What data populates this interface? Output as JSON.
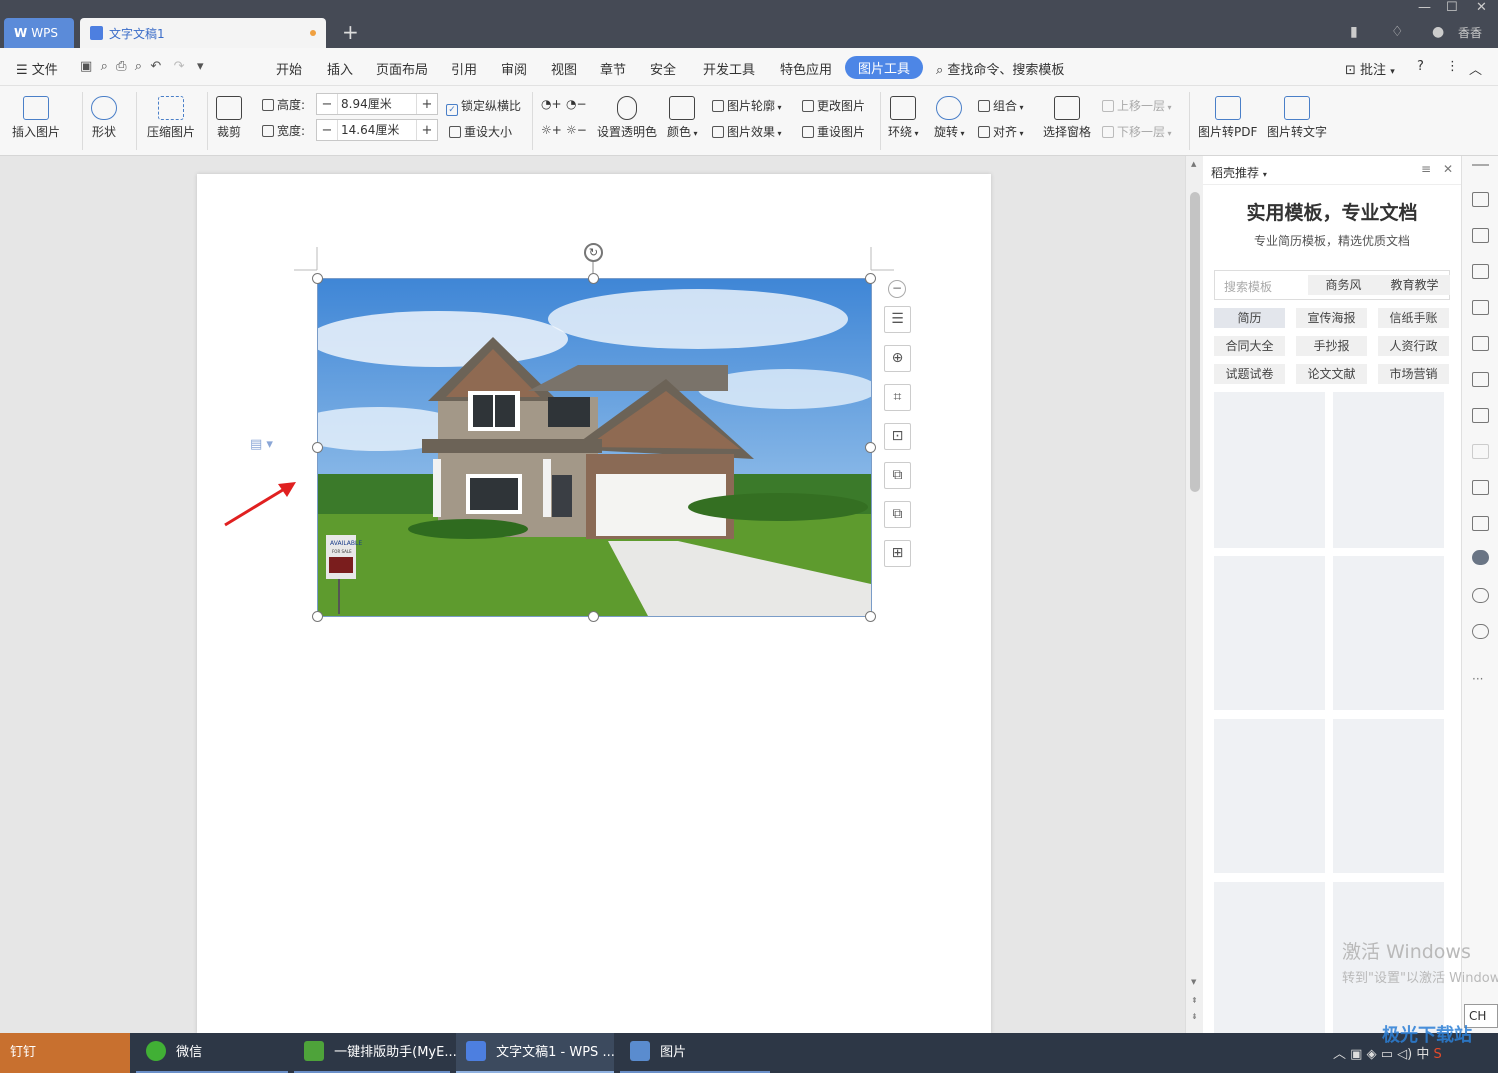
{
  "titlebar": {
    "app_tab": "WPS",
    "doc_tab": "文字文稿1",
    "user": "香香"
  },
  "menu": {
    "file": "文件",
    "items": [
      "开始",
      "插入",
      "页面布局",
      "引用",
      "审阅",
      "视图",
      "章节",
      "安全",
      "开发工具",
      "特色应用"
    ],
    "active": "图片工具",
    "search": "查找命令、搜索模板",
    "annotate": "批注",
    "help": "?"
  },
  "ribbon": {
    "insert_picture": "插入图片",
    "shape": "形状",
    "compress": "压缩图片",
    "crop": "裁剪",
    "height_label": "高度:",
    "height_value": "8.94厘米",
    "width_label": "宽度:",
    "width_value": "14.64厘米",
    "lock_ratio": "锁定纵横比",
    "reset_size": "重设大小",
    "set_transparent": "设置透明色",
    "color": "颜色",
    "outline": "图片轮廓",
    "effects": "图片效果",
    "change_picture": "更改图片",
    "reset_picture": "重设图片",
    "wrap": "环绕",
    "rotate": "旋转",
    "group": "组合",
    "align": "对齐",
    "selection_pane": "选择窗格",
    "bring_forward": "上移一层",
    "send_backward": "下移一层",
    "to_pdf": "图片转PDF",
    "to_text": "图片转文字"
  },
  "photo": {
    "sign_line1": "AVAILABLE",
    "sign_line2": "FOR SALE"
  },
  "panel": {
    "header": "稻壳推荐",
    "title": "实用模板，专业文档",
    "subtitle": "专业简历模板，精选优质文档",
    "search_placeholder": "搜索模板",
    "search_tabs": [
      "商务风",
      "教育教学"
    ],
    "categories": [
      "简历",
      "宣传海报",
      "信纸手账",
      "合同大全",
      "手抄报",
      "人资行政",
      "试题试卷",
      "论文文献",
      "市场营销"
    ]
  },
  "watermark": {
    "line1": "激活 Windows",
    "line2": "转到\"设置\"以激活 Windows"
  },
  "ime": "CH",
  "taskbar": {
    "items": [
      "钉钉",
      "微信",
      "一键排版助手(MyE...",
      "文字文稿1 - WPS ...",
      "图片"
    ],
    "tray_ime": "中",
    "site_logo": "极光下载站"
  }
}
